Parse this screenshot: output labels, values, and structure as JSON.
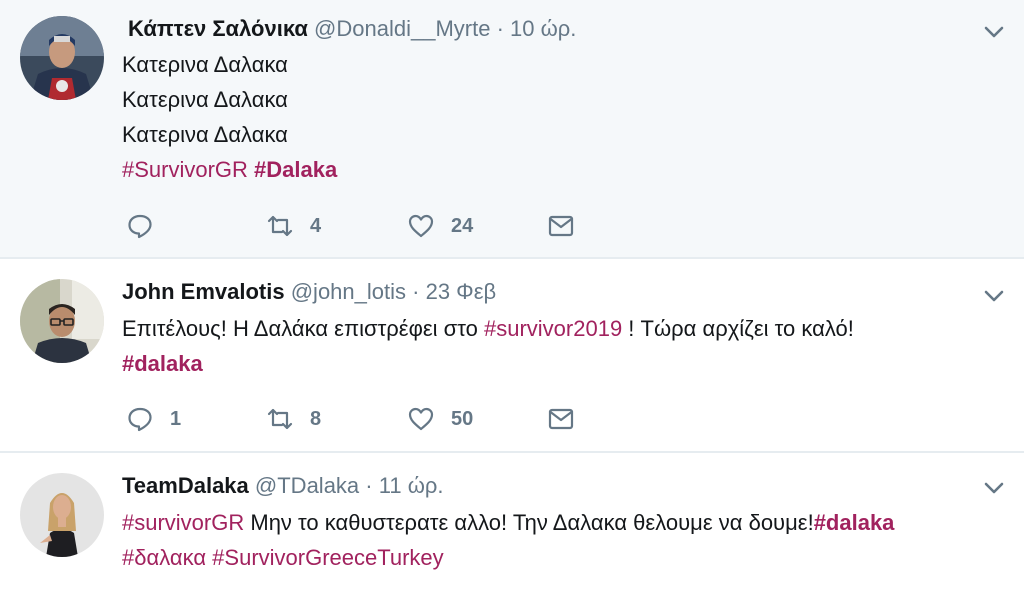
{
  "tweets": [
    {
      "lock_glyph": "",
      "name": "Κάπτεν Σαλόνικα",
      "handle": "@Donaldi__Myrte",
      "separator": "·",
      "time": "10 ώρ.",
      "lines": [
        "Κατερινα Δαλακα",
        "Κατερινα Δαλακα",
        "Κατερινα Δαλακα"
      ],
      "tags": [
        "#SurvivorGR",
        "#Dalaka"
      ],
      "replies": "",
      "retweets": "4",
      "likes": "24",
      "avatar_icon": "superhero-avatar"
    },
    {
      "name": "John Emvalotis",
      "handle": "@john_lotis",
      "separator": "·",
      "time": "23 Φεβ",
      "text_before": "Επιτέλους! Η Δαλάκα επιστρέφει στο ",
      "tag_inline": "#survivor2019",
      "text_after": " ! Τώρα αρχίζει το καλό!",
      "tag_line2": "#dalaka",
      "replies": "1",
      "retweets": "8",
      "likes": "50",
      "avatar_icon": "man-with-glasses-avatar"
    },
    {
      "name": "TeamDalaka",
      "handle": "@TDalaka",
      "separator": "·",
      "time": "11 ώρ.",
      "tag_start": "#survivorGR",
      "text_middle": " Μην το καθυστερατε αλλο! Την Δαλακα θελουμε να δουμε!",
      "tag_end": "#dalaka",
      "tag_line2_a": "#δαλακα",
      "tag_line2_b": "#SurvivorGreeceTurkey",
      "avatar_icon": "woman-avatar"
    }
  ],
  "colors": {
    "hashtag": "#a1225e",
    "secondary_text": "#657786",
    "highlight_bg": "#f5f8fa",
    "divider": "#e6ecf0"
  },
  "icons": {
    "reply": "reply-icon",
    "retweet": "retweet-icon",
    "like": "heart-icon",
    "message": "envelope-icon",
    "caret": "chevron-down-icon"
  }
}
